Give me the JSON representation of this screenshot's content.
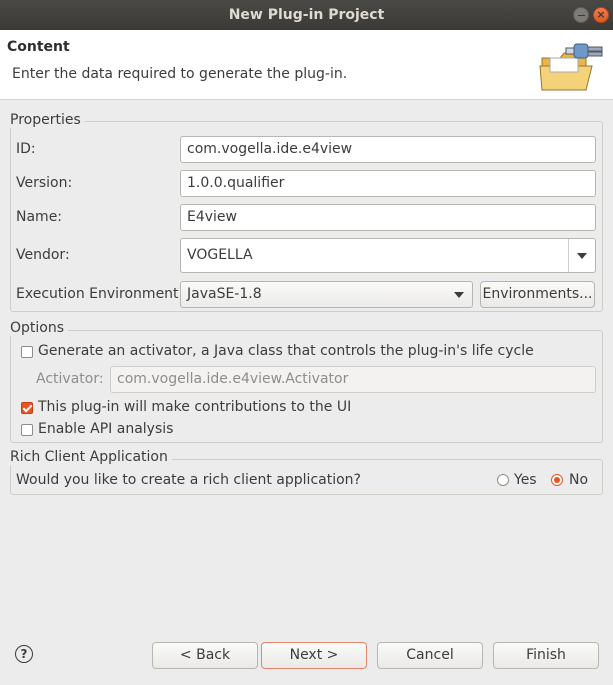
{
  "window": {
    "title": "New Plug-in Project"
  },
  "header": {
    "title": "Content",
    "message": "Enter the data required to generate the plug-in."
  },
  "properties": {
    "group_label": "Properties",
    "id_label": "ID:",
    "id_value": "com.vogella.ide.e4view",
    "version_label": "Version:",
    "version_value": "1.0.0.qualifier",
    "name_label": "Name:",
    "name_value": "E4view",
    "vendor_label": "Vendor:",
    "vendor_value": "VOGELLA",
    "exec_env_label": "Execution Environment:",
    "exec_env_value": "JavaSE-1.8",
    "environments_button": "Environments..."
  },
  "options": {
    "group_label": "Options",
    "generate_activator_label": "Generate an activator, a Java class that controls the plug-in's life cycle",
    "generate_activator_checked": false,
    "activator_label": "Activator:",
    "activator_value": "com.vogella.ide.e4view.Activator",
    "ui_contrib_label": "This plug-in will make contributions to the UI",
    "ui_contrib_checked": true,
    "api_analysis_label": "Enable API analysis",
    "api_analysis_checked": false
  },
  "rca": {
    "group_label": "Rich Client Application",
    "question": "Would you like to create a rich client application?",
    "yes_label": "Yes",
    "no_label": "No",
    "selected": "No"
  },
  "footer": {
    "help_icon": "help-icon",
    "back_button": "< Back",
    "next_button": "Next >",
    "cancel_button": "Cancel",
    "finish_button": "Finish"
  },
  "colors": {
    "accent": "#e95420",
    "titlebar": "#3b3a36",
    "background": "#ececec"
  }
}
